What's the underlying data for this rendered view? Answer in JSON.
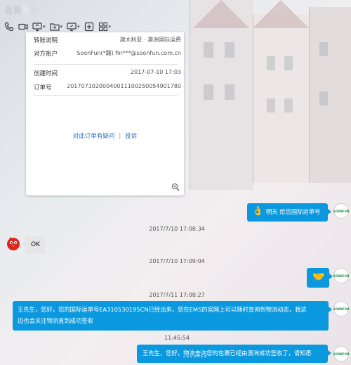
{
  "toolbar": {
    "items": [
      "phone-icon",
      "video-icon",
      "screen-share-icon",
      "folder-icon",
      "remote-desktop-icon",
      "add-icon",
      "apps-icon"
    ]
  },
  "card": {
    "row0_label": "转账说明",
    "row0_value": "澳大利亚 · 澳洲国际运费",
    "row1_label": "对方账户",
    "row1_value": "SoonFun(*蹦) fin***@soonfun.com.cn",
    "row2_label": "创建时间",
    "row2_value": "2017-07-10 17:03",
    "row3_label": "订单号",
    "row3_value": "20170710200040011100250054901780",
    "link_question": "对此订单有疑问",
    "link_complaint": "投诉"
  },
  "messages": {
    "m1_text": "明天 给您国际运单号",
    "m1_emoji": "👌",
    "ts1": "2017/7/10 17:08:34",
    "m2_text": "OK",
    "ts2": "2017/7/10 17:09:04",
    "m3_emoji": "🤝",
    "ts3": "2017/7/11 17:08:27",
    "m4_line1": "王先生，您好，您的国际运单号EA310530195CN已经出来，您在EMS的官网上可以随时查询到物流动态，我这",
    "m4_line2": "边也会关注物流直到成功签收",
    "ts4": "11:45:54",
    "m5_pre": "王先生，您好，",
    "m5_link": "物流查询",
    "m5_post": "您的包裹已经由澳洲成功签收了，请知悉"
  },
  "avatar_label": "SOONFUN",
  "colors": {
    "bubble_blue": "#0a98df",
    "bubble_grey": "#e6e6e6",
    "link": "#2a6ebd"
  }
}
